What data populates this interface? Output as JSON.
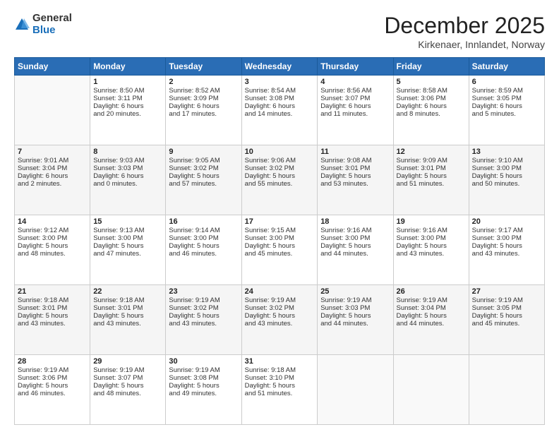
{
  "logo": {
    "general": "General",
    "blue": "Blue"
  },
  "title": "December 2025",
  "subtitle": "Kirkenaer, Innlandet, Norway",
  "days_header": [
    "Sunday",
    "Monday",
    "Tuesday",
    "Wednesday",
    "Thursday",
    "Friday",
    "Saturday"
  ],
  "weeks": [
    [
      {
        "day": "",
        "lines": []
      },
      {
        "day": "1",
        "lines": [
          "Sunrise: 8:50 AM",
          "Sunset: 3:11 PM",
          "Daylight: 6 hours",
          "and 20 minutes."
        ]
      },
      {
        "day": "2",
        "lines": [
          "Sunrise: 8:52 AM",
          "Sunset: 3:09 PM",
          "Daylight: 6 hours",
          "and 17 minutes."
        ]
      },
      {
        "day": "3",
        "lines": [
          "Sunrise: 8:54 AM",
          "Sunset: 3:08 PM",
          "Daylight: 6 hours",
          "and 14 minutes."
        ]
      },
      {
        "day": "4",
        "lines": [
          "Sunrise: 8:56 AM",
          "Sunset: 3:07 PM",
          "Daylight: 6 hours",
          "and 11 minutes."
        ]
      },
      {
        "day": "5",
        "lines": [
          "Sunrise: 8:58 AM",
          "Sunset: 3:06 PM",
          "Daylight: 6 hours",
          "and 8 minutes."
        ]
      },
      {
        "day": "6",
        "lines": [
          "Sunrise: 8:59 AM",
          "Sunset: 3:05 PM",
          "Daylight: 6 hours",
          "and 5 minutes."
        ]
      }
    ],
    [
      {
        "day": "7",
        "lines": [
          "Sunrise: 9:01 AM",
          "Sunset: 3:04 PM",
          "Daylight: 6 hours",
          "and 2 minutes."
        ]
      },
      {
        "day": "8",
        "lines": [
          "Sunrise: 9:03 AM",
          "Sunset: 3:03 PM",
          "Daylight: 6 hours",
          "and 0 minutes."
        ]
      },
      {
        "day": "9",
        "lines": [
          "Sunrise: 9:05 AM",
          "Sunset: 3:02 PM",
          "Daylight: 5 hours",
          "and 57 minutes."
        ]
      },
      {
        "day": "10",
        "lines": [
          "Sunrise: 9:06 AM",
          "Sunset: 3:02 PM",
          "Daylight: 5 hours",
          "and 55 minutes."
        ]
      },
      {
        "day": "11",
        "lines": [
          "Sunrise: 9:08 AM",
          "Sunset: 3:01 PM",
          "Daylight: 5 hours",
          "and 53 minutes."
        ]
      },
      {
        "day": "12",
        "lines": [
          "Sunrise: 9:09 AM",
          "Sunset: 3:01 PM",
          "Daylight: 5 hours",
          "and 51 minutes."
        ]
      },
      {
        "day": "13",
        "lines": [
          "Sunrise: 9:10 AM",
          "Sunset: 3:00 PM",
          "Daylight: 5 hours",
          "and 50 minutes."
        ]
      }
    ],
    [
      {
        "day": "14",
        "lines": [
          "Sunrise: 9:12 AM",
          "Sunset: 3:00 PM",
          "Daylight: 5 hours",
          "and 48 minutes."
        ]
      },
      {
        "day": "15",
        "lines": [
          "Sunrise: 9:13 AM",
          "Sunset: 3:00 PM",
          "Daylight: 5 hours",
          "and 47 minutes."
        ]
      },
      {
        "day": "16",
        "lines": [
          "Sunrise: 9:14 AM",
          "Sunset: 3:00 PM",
          "Daylight: 5 hours",
          "and 46 minutes."
        ]
      },
      {
        "day": "17",
        "lines": [
          "Sunrise: 9:15 AM",
          "Sunset: 3:00 PM",
          "Daylight: 5 hours",
          "and 45 minutes."
        ]
      },
      {
        "day": "18",
        "lines": [
          "Sunrise: 9:16 AM",
          "Sunset: 3:00 PM",
          "Daylight: 5 hours",
          "and 44 minutes."
        ]
      },
      {
        "day": "19",
        "lines": [
          "Sunrise: 9:16 AM",
          "Sunset: 3:00 PM",
          "Daylight: 5 hours",
          "and 43 minutes."
        ]
      },
      {
        "day": "20",
        "lines": [
          "Sunrise: 9:17 AM",
          "Sunset: 3:00 PM",
          "Daylight: 5 hours",
          "and 43 minutes."
        ]
      }
    ],
    [
      {
        "day": "21",
        "lines": [
          "Sunrise: 9:18 AM",
          "Sunset: 3:01 PM",
          "Daylight: 5 hours",
          "and 43 minutes."
        ]
      },
      {
        "day": "22",
        "lines": [
          "Sunrise: 9:18 AM",
          "Sunset: 3:01 PM",
          "Daylight: 5 hours",
          "and 43 minutes."
        ]
      },
      {
        "day": "23",
        "lines": [
          "Sunrise: 9:19 AM",
          "Sunset: 3:02 PM",
          "Daylight: 5 hours",
          "and 43 minutes."
        ]
      },
      {
        "day": "24",
        "lines": [
          "Sunrise: 9:19 AM",
          "Sunset: 3:02 PM",
          "Daylight: 5 hours",
          "and 43 minutes."
        ]
      },
      {
        "day": "25",
        "lines": [
          "Sunrise: 9:19 AM",
          "Sunset: 3:03 PM",
          "Daylight: 5 hours",
          "and 44 minutes."
        ]
      },
      {
        "day": "26",
        "lines": [
          "Sunrise: 9:19 AM",
          "Sunset: 3:04 PM",
          "Daylight: 5 hours",
          "and 44 minutes."
        ]
      },
      {
        "day": "27",
        "lines": [
          "Sunrise: 9:19 AM",
          "Sunset: 3:05 PM",
          "Daylight: 5 hours",
          "and 45 minutes."
        ]
      }
    ],
    [
      {
        "day": "28",
        "lines": [
          "Sunrise: 9:19 AM",
          "Sunset: 3:06 PM",
          "Daylight: 5 hours",
          "and 46 minutes."
        ]
      },
      {
        "day": "29",
        "lines": [
          "Sunrise: 9:19 AM",
          "Sunset: 3:07 PM",
          "Daylight: 5 hours",
          "and 48 minutes."
        ]
      },
      {
        "day": "30",
        "lines": [
          "Sunrise: 9:19 AM",
          "Sunset: 3:08 PM",
          "Daylight: 5 hours",
          "and 49 minutes."
        ]
      },
      {
        "day": "31",
        "lines": [
          "Sunrise: 9:18 AM",
          "Sunset: 3:10 PM",
          "Daylight: 5 hours",
          "and 51 minutes."
        ]
      },
      {
        "day": "",
        "lines": []
      },
      {
        "day": "",
        "lines": []
      },
      {
        "day": "",
        "lines": []
      }
    ]
  ]
}
